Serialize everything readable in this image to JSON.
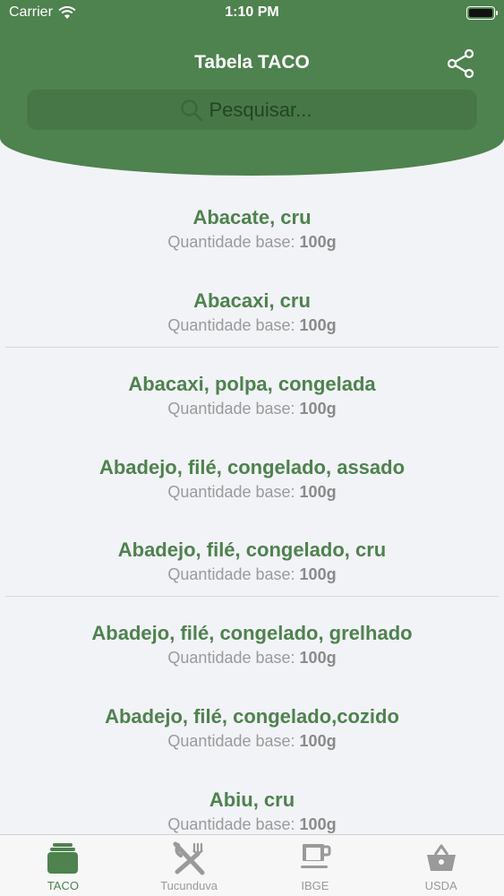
{
  "status": {
    "carrier": "Carrier",
    "time": "1:10 PM"
  },
  "header": {
    "title": "Tabela TACO"
  },
  "search": {
    "placeholder": "Pesquisar..."
  },
  "items": [
    {
      "name": "Abacate, cru",
      "qty_label": "Quantidade base:",
      "qty_value": "100g"
    },
    {
      "name": "Abacaxi, cru",
      "qty_label": "Quantidade base:",
      "qty_value": "100g"
    },
    {
      "name": "Abacaxi, polpa, congelada",
      "qty_label": "Quantidade base:",
      "qty_value": "100g"
    },
    {
      "name": "Abadejo, filé, congelado, assado",
      "qty_label": "Quantidade base:",
      "qty_value": "100g"
    },
    {
      "name": "Abadejo, filé, congelado, cru",
      "qty_label": "Quantidade base:",
      "qty_value": "100g"
    },
    {
      "name": "Abadejo, filé, congelado, grelhado",
      "qty_label": "Quantidade base:",
      "qty_value": "100g"
    },
    {
      "name": "Abadejo, filé, congelado,cozido",
      "qty_label": "Quantidade base:",
      "qty_value": "100g"
    },
    {
      "name": "Abiu, cru",
      "qty_label": "Quantidade base:",
      "qty_value": "100g"
    }
  ],
  "tabs": [
    {
      "label": "TACO",
      "icon": "folder-icon",
      "active": true
    },
    {
      "label": "Tucunduva",
      "icon": "fork-knife-icon",
      "active": false
    },
    {
      "label": "IBGE",
      "icon": "cup-icon",
      "active": false
    },
    {
      "label": "USDA",
      "icon": "basket-icon",
      "active": false
    }
  ],
  "colors": {
    "accent": "#4e824e",
    "inactive": "#9a9a9a",
    "background": "#f2f3f7"
  }
}
